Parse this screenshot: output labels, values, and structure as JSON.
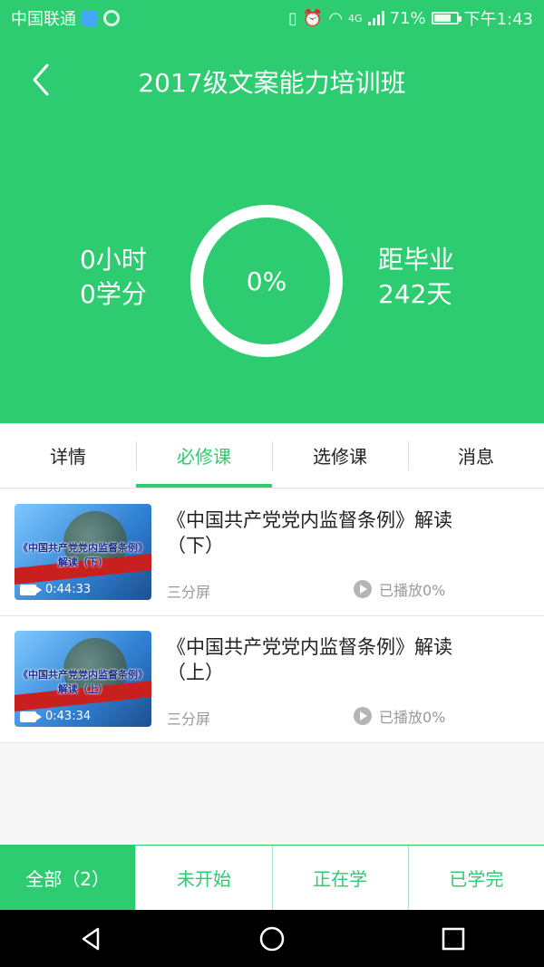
{
  "status_bar": {
    "carrier": "中国联通",
    "battery": "71%",
    "time": "下午1:43",
    "network": "4G"
  },
  "header": {
    "title": "2017级文案能力培训班",
    "back_icon": "chevron-left-icon"
  },
  "stats": {
    "hours": "0小时",
    "credits": "0学分",
    "progress": "0%",
    "graduation_label": "距毕业",
    "days_left": "242天"
  },
  "tabs": [
    {
      "label": "详情"
    },
    {
      "label": "必修课"
    },
    {
      "label": "选修课"
    },
    {
      "label": "消息"
    }
  ],
  "active_tab": "必修课",
  "courses": [
    {
      "title": "《中国共产党党内监督条例》解读（下）",
      "thumb_caption_1": "《中国共产党党内监督条例》",
      "thumb_caption_2": "解读（下）",
      "duration": "0:44:33",
      "screen_type": "三分屏",
      "played": "已播放0%"
    },
    {
      "title": "《中国共产党党内监督条例》解读（上）",
      "thumb_caption_1": "《中国共产党党内监督条例》",
      "thumb_caption_2": "解读（上）",
      "duration": "0:43:34",
      "screen_type": "三分屏",
      "played": "已播放0%"
    }
  ],
  "filters": [
    {
      "label": "全部（2）"
    },
    {
      "label": "未开始"
    },
    {
      "label": "正在学"
    },
    {
      "label": "已学完"
    }
  ],
  "colors": {
    "accent": "#2ecc71",
    "text": "#222222",
    "muted": "#999999"
  }
}
